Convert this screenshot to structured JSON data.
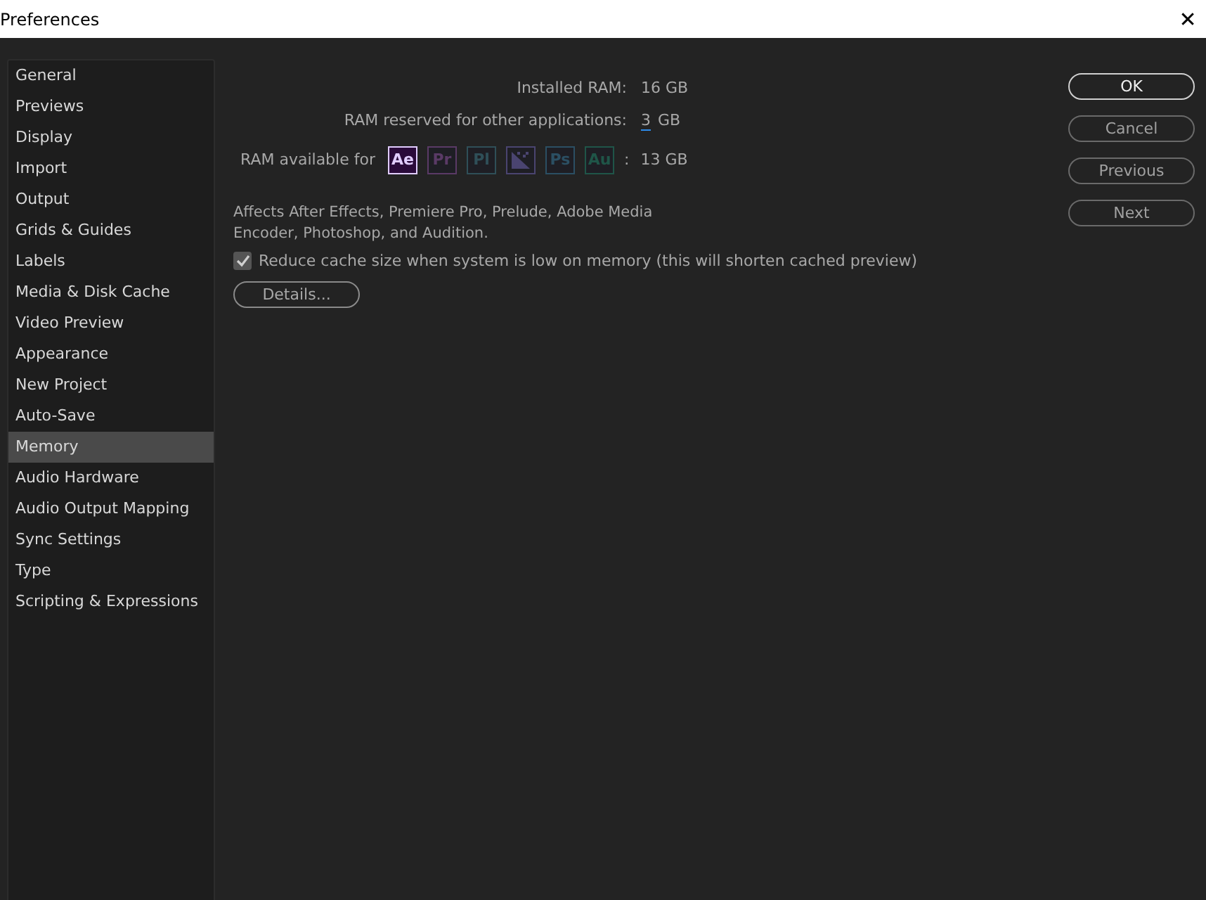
{
  "window": {
    "title": "Preferences",
    "close": "✕"
  },
  "sidebar": {
    "items": [
      {
        "label": "General",
        "selected": false
      },
      {
        "label": "Previews",
        "selected": false
      },
      {
        "label": "Display",
        "selected": false
      },
      {
        "label": "Import",
        "selected": false
      },
      {
        "label": "Output",
        "selected": false
      },
      {
        "label": "Grids & Guides",
        "selected": false
      },
      {
        "label": "Labels",
        "selected": false
      },
      {
        "label": "Media & Disk Cache",
        "selected": false
      },
      {
        "label": "Video Preview",
        "selected": false
      },
      {
        "label": "Appearance",
        "selected": false
      },
      {
        "label": "New Project",
        "selected": false
      },
      {
        "label": "Auto-Save",
        "selected": false
      },
      {
        "label": "Memory",
        "selected": true
      },
      {
        "label": "Audio Hardware",
        "selected": false
      },
      {
        "label": "Audio Output Mapping",
        "selected": false
      },
      {
        "label": "Sync Settings",
        "selected": false
      },
      {
        "label": "Type",
        "selected": false
      },
      {
        "label": "Scripting & Expressions",
        "selected": false
      }
    ]
  },
  "memory": {
    "installed_label": "Installed RAM:",
    "installed_value": "16 GB",
    "reserved_label": "RAM reserved for other applications:",
    "reserved_value": "3",
    "reserved_unit": "GB",
    "available_label": "RAM available for",
    "apps": [
      {
        "kind": "text",
        "label": "Ae",
        "color": "#e0ccff",
        "selected": true
      },
      {
        "kind": "text",
        "label": "Pr",
        "color": "#5a3a66",
        "selected": false
      },
      {
        "kind": "text",
        "label": "Pl",
        "color": "#2f4f58",
        "selected": false
      },
      {
        "kind": "drawing",
        "color": "#4a4470",
        "selected": false
      },
      {
        "kind": "text",
        "label": "Ps",
        "color": "#2b4f63",
        "selected": false
      },
      {
        "kind": "text",
        "label": "Au",
        "color": "#1f5548",
        "selected": false
      }
    ],
    "separator": ":",
    "available_value": "13 GB",
    "note": "Affects After Effects, Premiere Pro, Prelude, Adobe Media Encoder, Photoshop, and Audition.",
    "reduce_cache": {
      "label": "Reduce cache size when system is low on memory (this will shorten cached preview)",
      "checked": true
    },
    "details_button": "Details..."
  },
  "buttons": [
    {
      "label": "OK",
      "default": true
    },
    {
      "label": "Cancel",
      "default": false
    },
    {
      "label": "Previous",
      "default": false
    },
    {
      "label": "Next",
      "default": false
    }
  ]
}
